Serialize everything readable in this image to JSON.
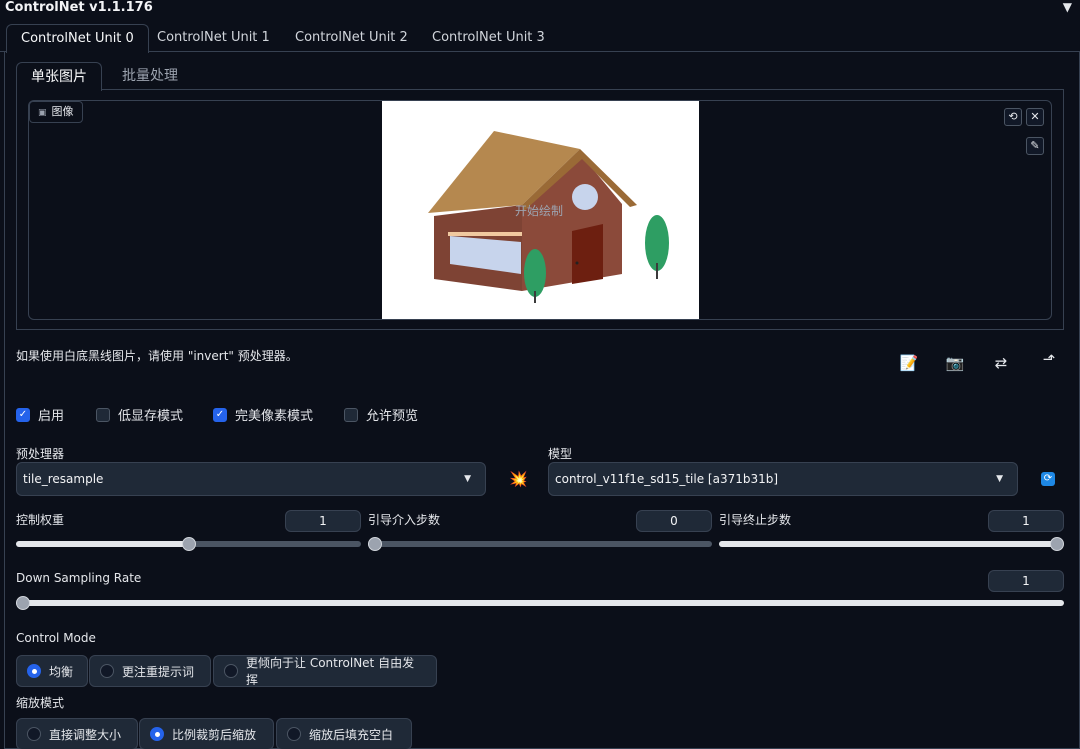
{
  "header": {
    "title": "ControlNet v1.1.176",
    "collapse_icon": "▼"
  },
  "unit_tabs": [
    "ControlNet Unit 0",
    "ControlNet Unit 1",
    "ControlNet Unit 2",
    "ControlNet Unit 3"
  ],
  "sub_tabs": [
    "单张图片",
    "批量处理"
  ],
  "image_panel": {
    "label": "图像",
    "overlay_text": "开始绘制"
  },
  "hint": "如果使用白底黑线图片，请使用 \"invert\" 预处理器。",
  "checkboxes": [
    {
      "label": "启用",
      "checked": true
    },
    {
      "label": "低显存模式",
      "checked": false
    },
    {
      "label": "完美像素模式",
      "checked": true
    },
    {
      "label": "允许预览",
      "checked": false
    }
  ],
  "preprocessor": {
    "label": "预处理器",
    "value": "tile_resample"
  },
  "model": {
    "label": "模型",
    "value": "control_v11f1e_sd15_tile [a371b31b]"
  },
  "sliders": {
    "control_weight": {
      "label": "控制权重",
      "value": "1",
      "fraction": 0.5
    },
    "start_step": {
      "label": "引导介入步数",
      "value": "0",
      "fraction": 0.0
    },
    "end_step": {
      "label": "引导终止步数",
      "value": "1",
      "fraction": 1.0
    },
    "down_sampling": {
      "label": "Down Sampling Rate",
      "value": "1",
      "fraction": 0.0
    }
  },
  "control_mode": {
    "label": "Control Mode",
    "options": [
      "均衡",
      "更注重提示词",
      "更倾向于让 ControlNet 自由发挥"
    ],
    "selected": 0
  },
  "resize_mode": {
    "label": "缩放模式",
    "options": [
      "直接调整大小",
      "比例裁剪后缩放",
      "缩放后填充空白"
    ],
    "selected": 1
  },
  "colors": {
    "accent": "#2563eb",
    "background": "#0b0f19",
    "roof": "#b5884f",
    "wall": "#8b4a3a",
    "tree": "#2e9e63"
  }
}
